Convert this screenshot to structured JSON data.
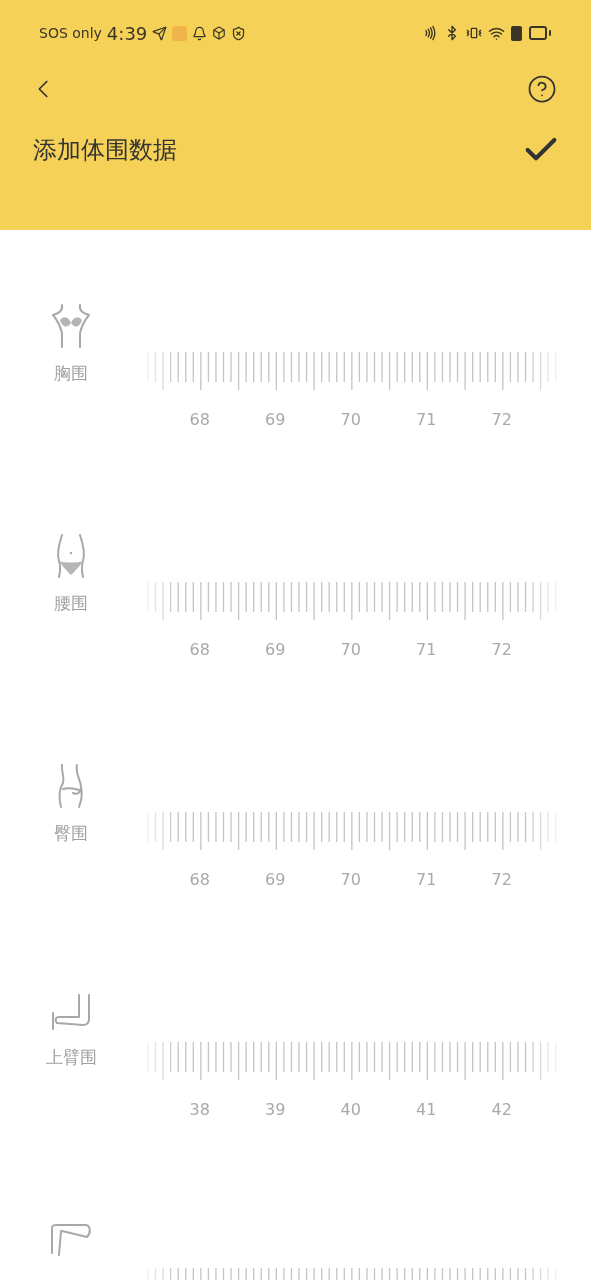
{
  "status_bar": {
    "carrier": "SOS only",
    "time": "4:39"
  },
  "header": {
    "title": "添加体围数据"
  },
  "measurements": [
    {
      "kind": "chest",
      "label": "胸围",
      "ticks": [
        "68",
        "69",
        "70",
        "71",
        "72"
      ]
    },
    {
      "kind": "waist",
      "label": "腰围",
      "ticks": [
        "68",
        "69",
        "70",
        "71",
        "72"
      ]
    },
    {
      "kind": "hip",
      "label": "臀围",
      "ticks": [
        "68",
        "69",
        "70",
        "71",
        "72"
      ]
    },
    {
      "kind": "arm",
      "label": "上臂围",
      "ticks": [
        "38",
        "39",
        "40",
        "41",
        "42"
      ]
    },
    {
      "kind": "leg"
    }
  ]
}
